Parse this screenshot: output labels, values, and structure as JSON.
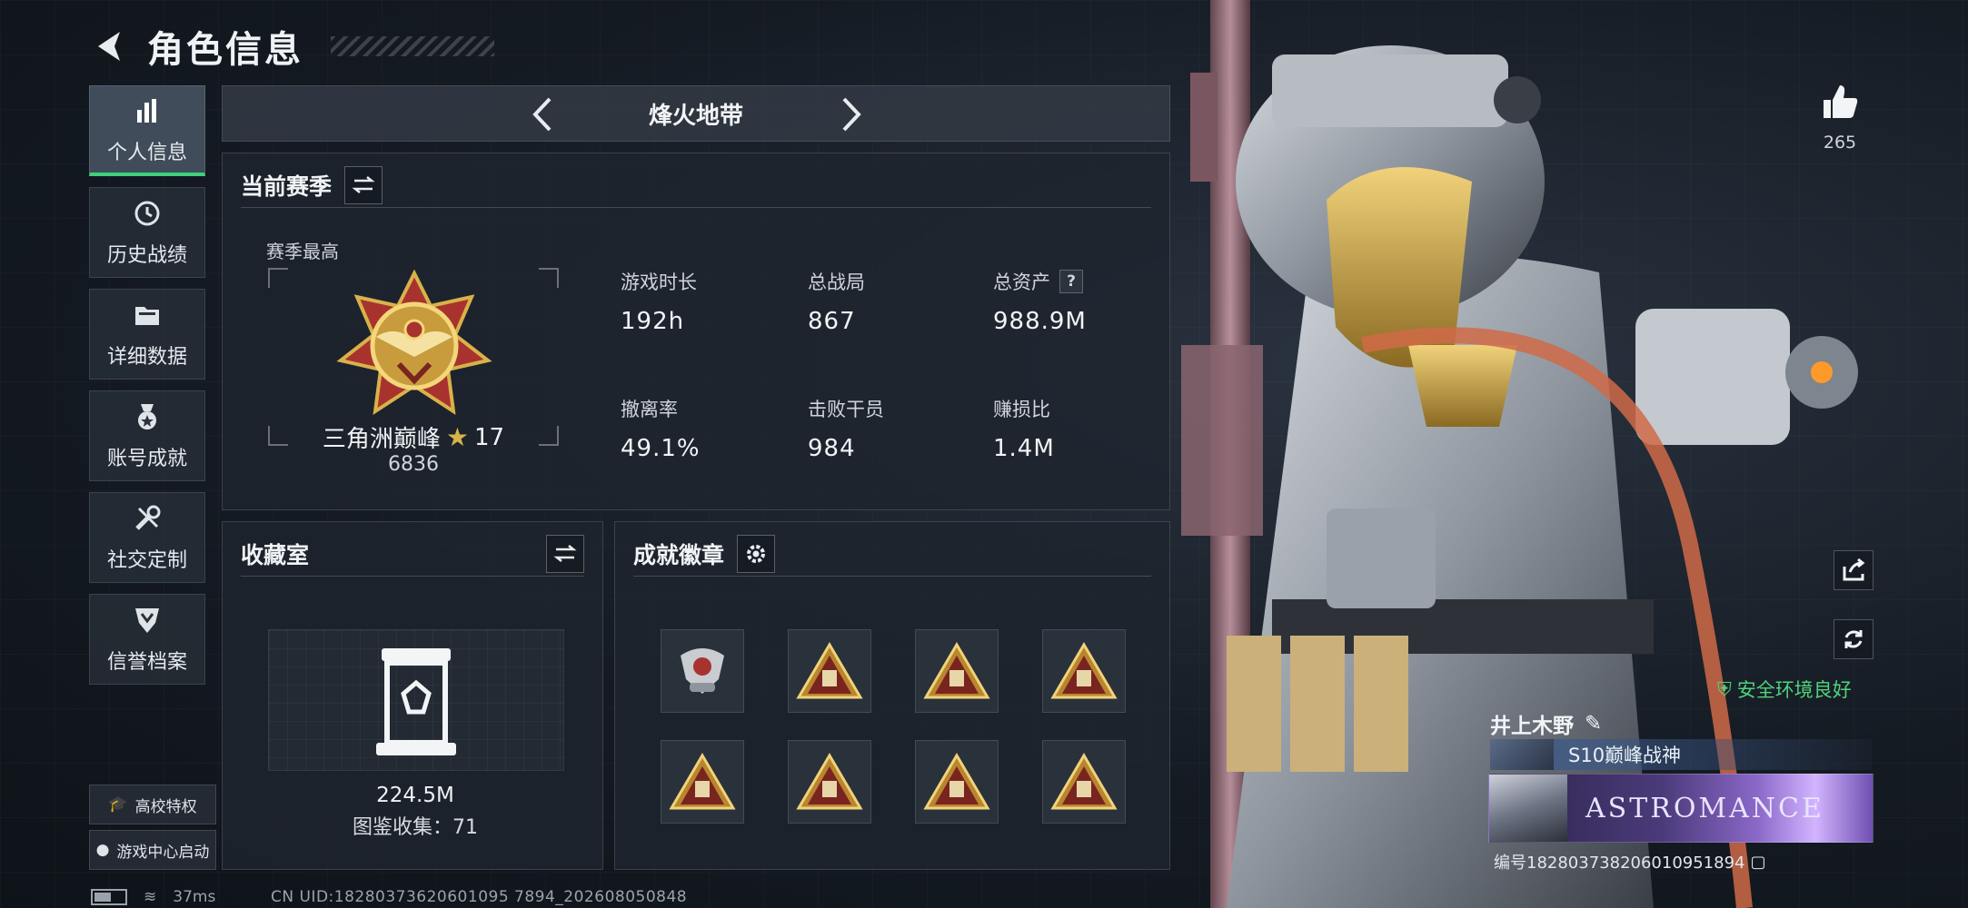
{
  "header": {
    "title": "角色信息"
  },
  "sidebar": {
    "items": [
      {
        "label": "个人信息",
        "icon": "bar-chart-icon",
        "active": true
      },
      {
        "label": "历史战绩",
        "icon": "clock-icon"
      },
      {
        "label": "详细数据",
        "icon": "folder-icon"
      },
      {
        "label": "账号成就",
        "icon": "medal-icon"
      },
      {
        "label": "社交定制",
        "icon": "tools-icon"
      },
      {
        "label": "信誉档案",
        "icon": "shield-icon"
      }
    ],
    "campus_label": "高校特权",
    "game_center_label": "游戏中心启动"
  },
  "mode": {
    "title": "烽火地带"
  },
  "season": {
    "title": "当前赛季",
    "best_label": "赛季最高",
    "rank_name": "三角洲巅峰",
    "rank_stars": "17",
    "rank_score": "6836",
    "stats": [
      {
        "label": "游戏时长",
        "value": "192h"
      },
      {
        "label": "总战局",
        "value": "867"
      },
      {
        "label": "总资产",
        "value": "988.9M",
        "help": "?"
      },
      {
        "label": "撤离率",
        "value": "49.1%"
      },
      {
        "label": "击败干员",
        "value": "984"
      },
      {
        "label": "赚损比",
        "value": "1.4M"
      }
    ]
  },
  "collection": {
    "title": "收藏室",
    "value": "224.5M",
    "count_text": "图鉴收集：71"
  },
  "badges": {
    "title": "成就徽章",
    "count": 8
  },
  "status_bar": {
    "ping": "37ms",
    "uid_text": "CN UID:18280373620601095 7894_202608050848"
  },
  "profile": {
    "likes": "265",
    "safe_env": "安全环境良好",
    "player_name": "井上木野",
    "title_badge": "S10巅峰战神",
    "banner_text": "ASTROMANCE",
    "player_id": "编号182803738206010951894"
  },
  "colors": {
    "accent_green": "#3fd07a",
    "gold": "#d8b24a",
    "background": "#151b23"
  }
}
